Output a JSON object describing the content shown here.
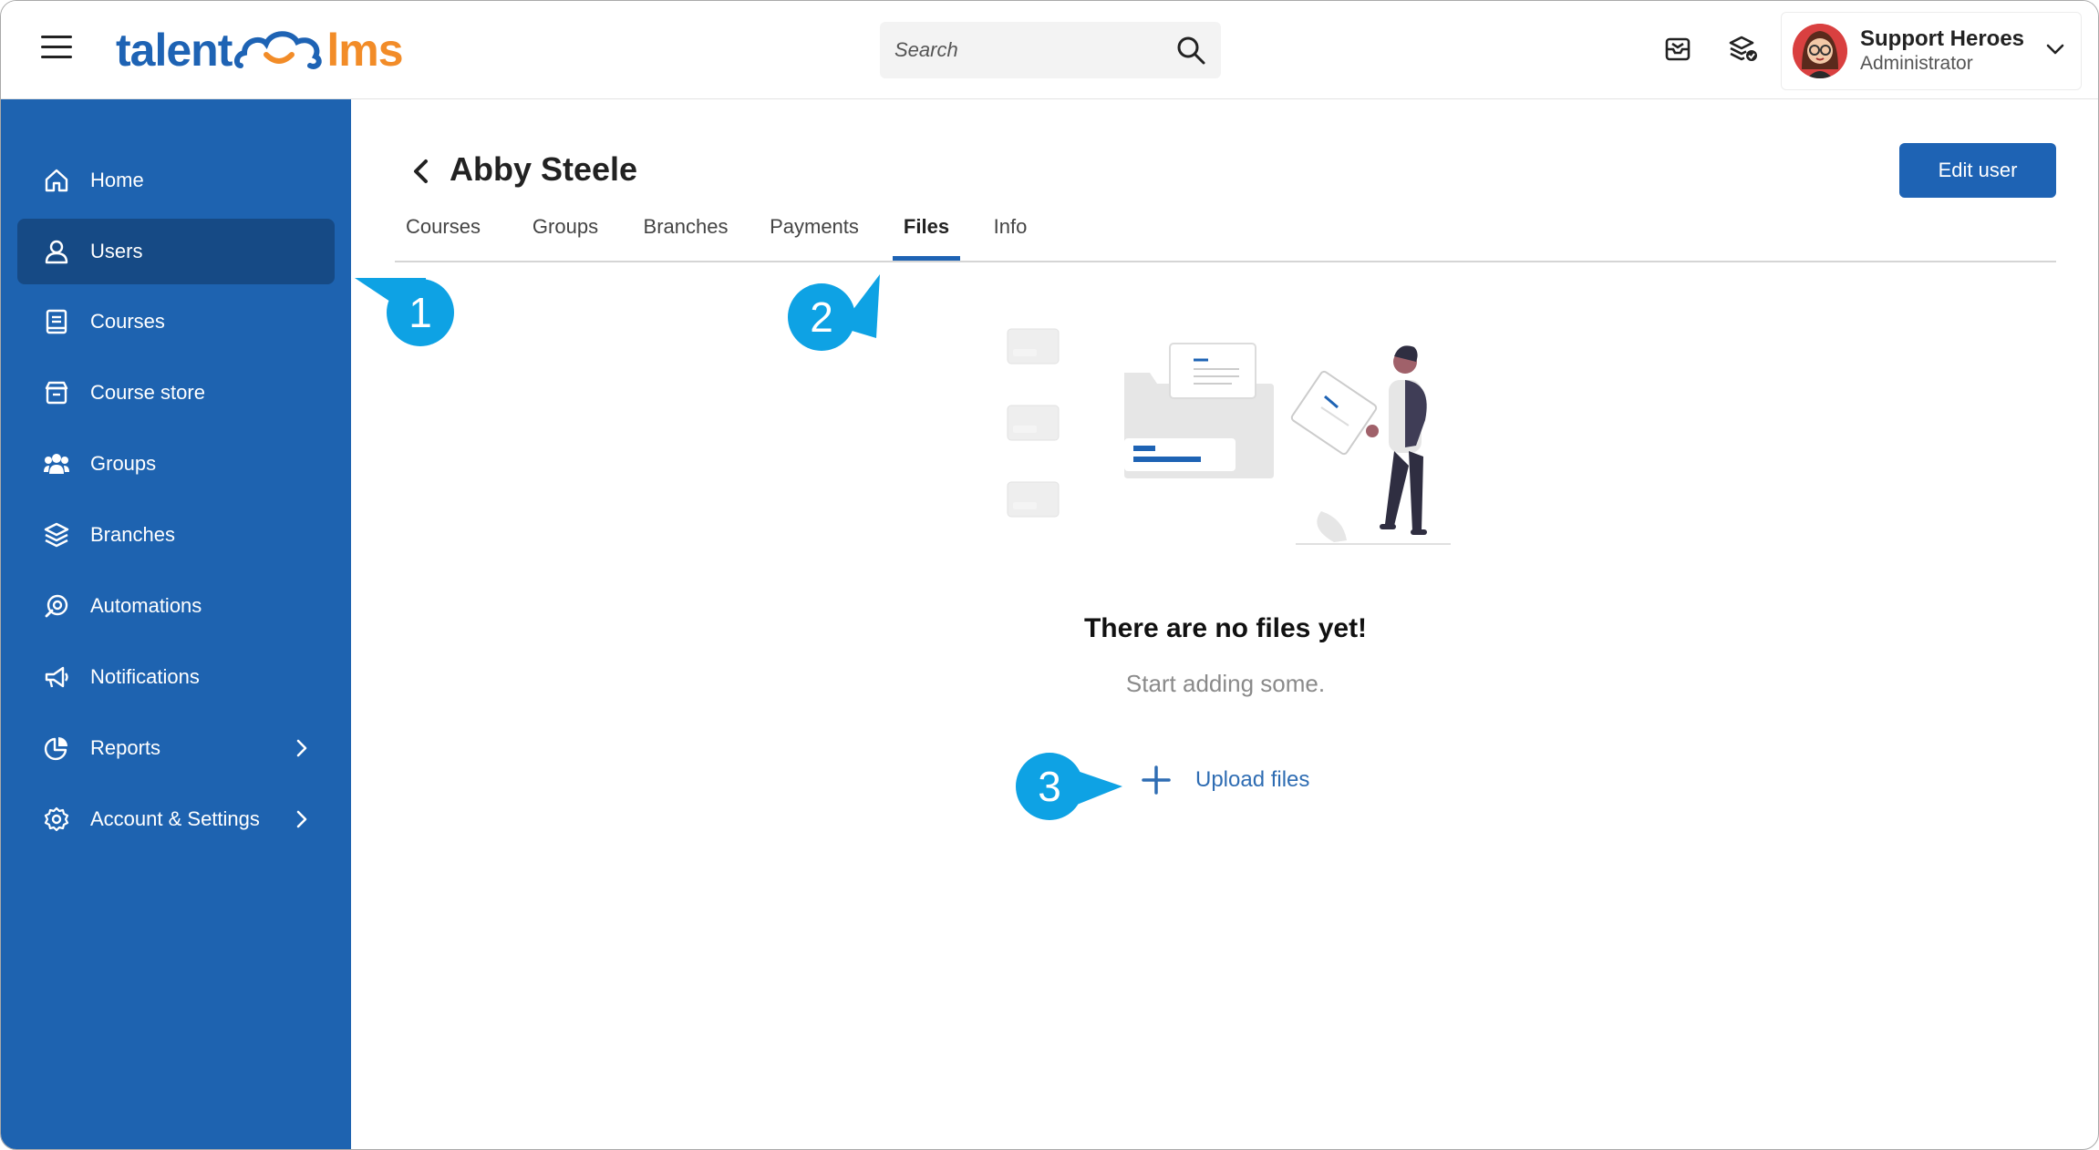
{
  "header": {
    "logo_left": "talent",
    "logo_right": "lms",
    "search_placeholder": "Search",
    "user": {
      "name": "Support Heroes",
      "role": "Administrator"
    }
  },
  "sidebar": {
    "items": [
      {
        "label": "Home",
        "icon": "home-icon"
      },
      {
        "label": "Users",
        "icon": "user-icon",
        "active": true
      },
      {
        "label": "Courses",
        "icon": "book-icon"
      },
      {
        "label": "Course store",
        "icon": "store-icon"
      },
      {
        "label": "Groups",
        "icon": "groups-icon"
      },
      {
        "label": "Branches",
        "icon": "layers-icon"
      },
      {
        "label": "Automations",
        "icon": "automation-icon"
      },
      {
        "label": "Notifications",
        "icon": "megaphone-icon"
      },
      {
        "label": "Reports",
        "icon": "pie-chart-icon",
        "has_submenu": true
      },
      {
        "label": "Account & Settings",
        "icon": "gear-icon",
        "has_submenu": true
      }
    ]
  },
  "page": {
    "title": "Abby Steele",
    "edit_button": "Edit user",
    "tabs": [
      "Courses",
      "Groups",
      "Branches",
      "Payments",
      "Files",
      "Info"
    ],
    "active_tab": "Files"
  },
  "empty_state": {
    "title": "There are no files yet!",
    "subtitle": "Start adding some.",
    "upload_label": "Upload files"
  },
  "callouts": [
    "1",
    "2",
    "3"
  ],
  "colors": {
    "brand_blue": "#1e63b4",
    "sidebar_bg": "#1e63b0",
    "sidebar_active": "#164a85",
    "logo_orange": "#f28c28",
    "callout": "#0ea2e4"
  }
}
